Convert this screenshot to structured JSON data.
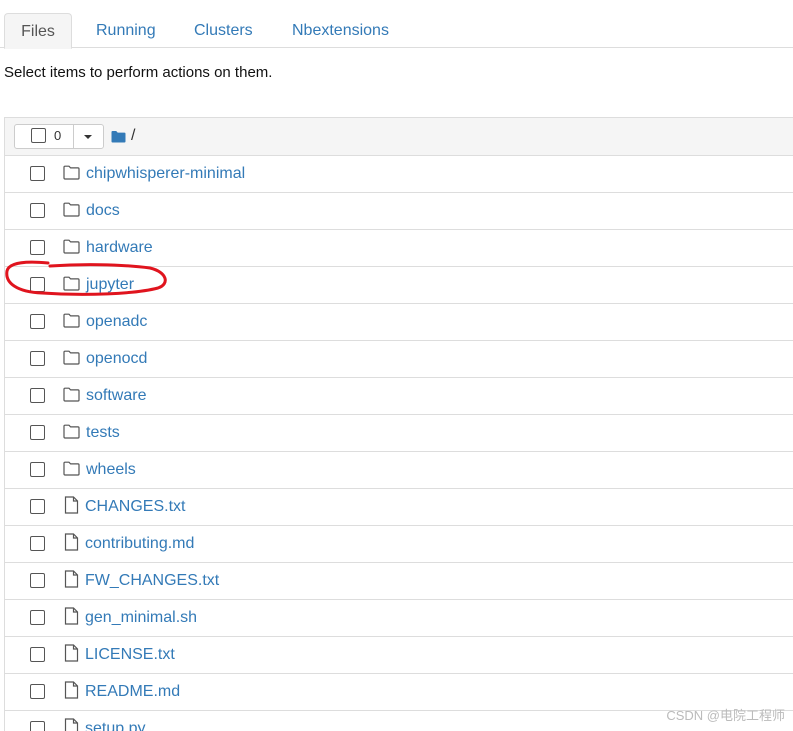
{
  "tabs": [
    {
      "label": "Files",
      "active": true
    },
    {
      "label": "Running",
      "active": false
    },
    {
      "label": "Clusters",
      "active": false
    },
    {
      "label": "Nbextensions",
      "active": false
    }
  ],
  "hint": "Select items to perform actions on them.",
  "toolbar": {
    "selected_count": "0",
    "breadcrumb": "/"
  },
  "items": [
    {
      "name": "chipwhisperer-minimal",
      "type": "folder"
    },
    {
      "name": "docs",
      "type": "folder"
    },
    {
      "name": "hardware",
      "type": "folder"
    },
    {
      "name": "jupyter",
      "type": "folder"
    },
    {
      "name": "openadc",
      "type": "folder"
    },
    {
      "name": "openocd",
      "type": "folder"
    },
    {
      "name": "software",
      "type": "folder"
    },
    {
      "name": "tests",
      "type": "folder"
    },
    {
      "name": "wheels",
      "type": "folder"
    },
    {
      "name": "CHANGES.txt",
      "type": "file"
    },
    {
      "name": "contributing.md",
      "type": "file"
    },
    {
      "name": "FW_CHANGES.txt",
      "type": "file"
    },
    {
      "name": "gen_minimal.sh",
      "type": "file"
    },
    {
      "name": "LICENSE.txt",
      "type": "file"
    },
    {
      "name": "README.md",
      "type": "file"
    },
    {
      "name": "setup.py",
      "type": "file"
    }
  ],
  "annotation": {
    "highlighted_item": "jupyter",
    "color": "#e0141e"
  },
  "watermark": "CSDN @电院工程师",
  "colors": {
    "link": "#337ab7",
    "header_bg": "#f5f5f5",
    "border": "#dddddd"
  }
}
